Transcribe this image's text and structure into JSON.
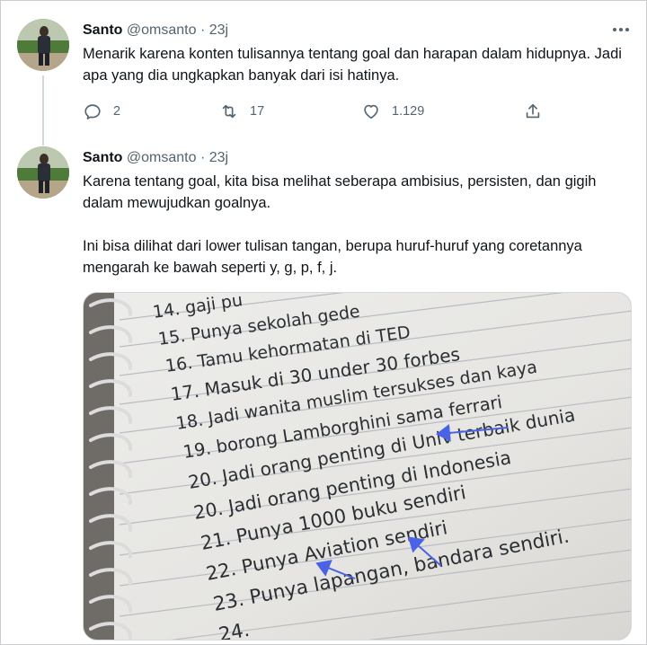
{
  "tweet1": {
    "name": "Santo",
    "handle": "@omsanto",
    "dot": "·",
    "time": "23j",
    "more_icon": "more-icon",
    "text": "Menarik karena konten tulisannya tentang goal dan harapan dalam hidupnya. Jadi apa yang dia ungkapkan banyak dari isi hatinya.",
    "reply_count": "2",
    "retweet_count": "17",
    "like_count": "1.129"
  },
  "tweet2": {
    "name": "Santo",
    "handle": "@omsanto",
    "dot": "·",
    "time": "23j",
    "para1": "Karena tentang goal, kita bisa melihat seberapa ambisius, persisten, dan gigih dalam mewujudkan goalnya.",
    "para2": "Ini bisa dilihat dari lower tulisan tangan, berupa huruf-huruf yang coretannya mengarah ke bawah seperti y, g, p, f, j."
  },
  "notebook": {
    "lines": [
      "14. gaji pu",
      "15. Punya sekolah gede",
      "16. Tamu kehormatan di TED",
      "17. Masuk di 30 under 30 forbes",
      "18. Jadi wanita muslim tersukses dan kaya",
      "19. borong Lamborghini sama ferrari",
      "20. Jadi orang penting di Univ terbaik dunia",
      "20. Jadi orang penting di Indonesia",
      "21. Punya 1000 buku sendiri",
      "22. Punya Aviation sendiri",
      "23. Punya lapangan, bandara sendiri.",
      "24."
    ]
  },
  "colors": {
    "text": "#0f1419",
    "muted": "#536471",
    "thread": "#cfd9de",
    "arrow": "#4a63e6",
    "ink": "#2b2f33"
  }
}
